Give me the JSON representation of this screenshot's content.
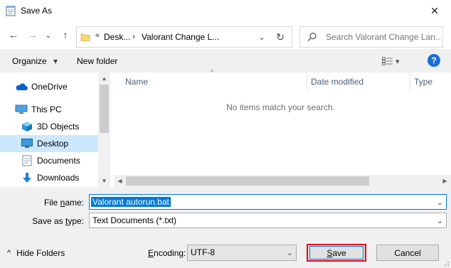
{
  "window": {
    "title": "Save As",
    "close_glyph": "✕"
  },
  "nav": {
    "back": "←",
    "forward": "→",
    "recent": "⌄",
    "up": "↑",
    "address_chevron": "«",
    "address_seg1": "Desk...",
    "address_sep": "›",
    "address_seg2": "Valorant Change L...",
    "address_dropdown": "⌄",
    "refresh": "↻",
    "search_placeholder": "Search Valorant Change Lan..."
  },
  "toolbar": {
    "organize": "Organize",
    "organize_arrow": "▾",
    "new_folder": "New folder",
    "view_arrow": "▾",
    "help": "?"
  },
  "sidebar": {
    "items": [
      {
        "label": "OneDrive"
      },
      {
        "label": "This PC"
      },
      {
        "label": "3D Objects"
      },
      {
        "label": "Desktop",
        "selected": true
      },
      {
        "label": "Documents"
      },
      {
        "label": "Downloads"
      }
    ],
    "scroll_up": "▲",
    "scroll_down": "▼"
  },
  "filelist": {
    "sort_indicator": "^",
    "columns": [
      "Name",
      "Date modified",
      "Type"
    ],
    "empty_message": "No items match your search.",
    "scroll_left": "◀",
    "scroll_right": "▶"
  },
  "form": {
    "file_name_label": {
      "pre": "File ",
      "key": "n",
      "post": "ame:"
    },
    "file_name_value": "Valorant autorun.bat",
    "save_type_label": {
      "pre": "Save as ",
      "key": "t",
      "post": "ype:"
    },
    "save_type_value": "Text Documents (*.txt)",
    "hide_folders": "Hide Folders",
    "hide_folders_caret": "^",
    "encoding_label": {
      "key": "E",
      "post": "ncoding:"
    },
    "encoding_value": "UTF-8",
    "save": {
      "key": "S",
      "post": "ave"
    },
    "cancel": "Cancel",
    "dropdown_glyph": "⌄"
  },
  "colors": {
    "accent": "#0078d7",
    "selection": "#cce8ff",
    "highlight_box": "#e3001b",
    "help": "#1a6ed8"
  }
}
